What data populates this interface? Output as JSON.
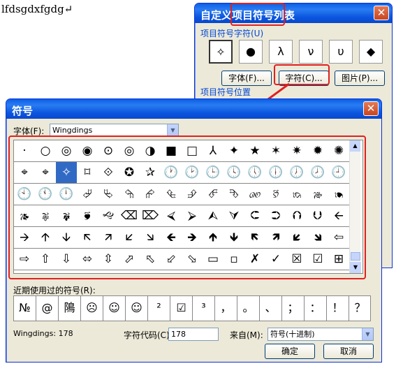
{
  "document": {
    "text": "lfdsgdxfgdg↵"
  },
  "list_dialog": {
    "title": "自定义项目符号列表",
    "symbols_label": "项目符号字符(U)",
    "symbols": [
      "✧",
      "●",
      "λ",
      "ν",
      "υ",
      "◆"
    ],
    "font_button": "字体(F)...",
    "char_button": "字符(C)...",
    "picture_button": "图片(P)...",
    "position_label": "项目符号位置"
  },
  "symbol_dialog": {
    "title": "符号",
    "font_label": "字体(F):",
    "font_value": "Wingdings",
    "grid": [
      [
        "·",
        "○",
        "◎",
        "◉",
        "⊙",
        "◎",
        "◑",
        "■",
        "□",
        "⅄",
        "✦",
        "★",
        "✶",
        "✷",
        "✹",
        "✺"
      ],
      [
        "⌖",
        "⌖",
        "✧",
        "⌑",
        "⟐",
        "✪",
        "✰",
        "🕐",
        "🕑",
        "🕒",
        "🕓",
        "🕔",
        "🕕",
        "🕖",
        "🕗",
        "🕘"
      ],
      [
        "🕙",
        "🕚",
        "🕛",
        "⮰",
        "⮱",
        "⮲",
        "⮳",
        "⮴",
        "⮵",
        "⮶",
        "⮷",
        "🙐",
        "🙑",
        "🙒",
        "🙓",
        "🙔"
      ],
      [
        "🙕",
        "🙖",
        "🙗",
        "🙘",
        "🙙",
        "⌫",
        "⌦",
        "⮘",
        "⮚",
        "⮙",
        "⮛",
        "⮈",
        "⮊",
        "⮉",
        "⮋",
        "🡨"
      ],
      [
        "🡪",
        "🡩",
        "🡫",
        "🡬",
        "🡭",
        "🡯",
        "🡮",
        "🡸",
        "🡺",
        "🡹",
        "🡻",
        "🡼",
        "🡽",
        "🡿",
        "🡾",
        "⇦"
      ],
      [
        "⇨",
        "⇧",
        "⇩",
        "⬄",
        "⇳",
        "⬀",
        "⬁",
        "⬃",
        "⬂",
        "▭",
        "▫",
        "✗",
        "✓",
        "☒",
        "☑",
        "⊞"
      ]
    ],
    "recent_label": "近期使用过的符号(R):",
    "recent": [
      "№",
      "@",
      "隝",
      "☹",
      "☺",
      "☺",
      "²",
      "☑",
      "³",
      "，",
      "。",
      "、",
      "；",
      "：",
      "！",
      "？"
    ],
    "status_text": "Wingdings: 178",
    "char_code_label": "字符代码(C):",
    "char_code_value": "178",
    "from_label": "来自(M):",
    "from_value": "符号(十进制)",
    "ok_button": "确定",
    "cancel_button": "取消"
  }
}
